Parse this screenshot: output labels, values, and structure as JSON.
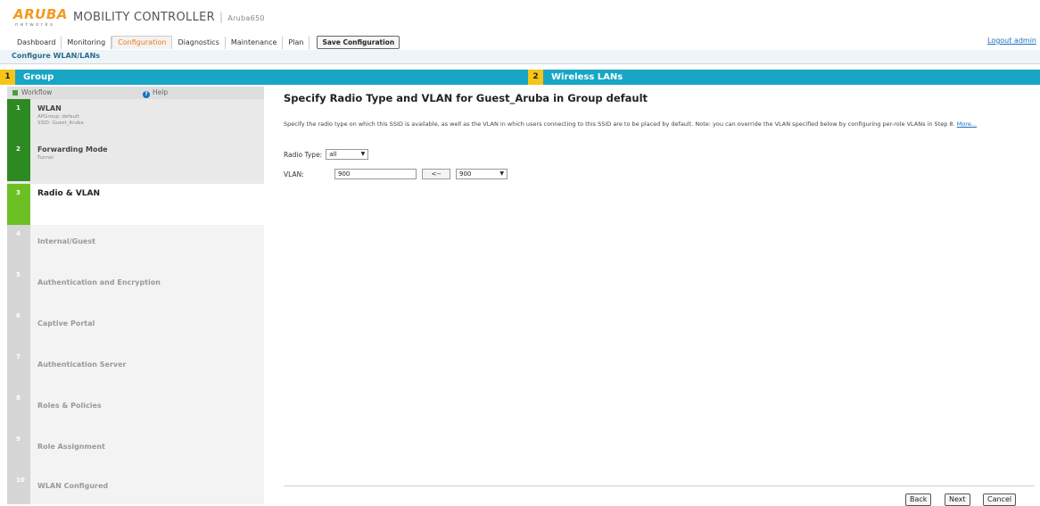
{
  "header": {
    "logo_text": "ARUBA",
    "logo_sub": "networks",
    "product": "MOBILITY CONTROLLER",
    "separator": "|",
    "hostname": "Aruba650"
  },
  "nav": {
    "tabs": [
      {
        "label": "Dashboard"
      },
      {
        "label": "Monitoring"
      },
      {
        "label": "Configuration"
      },
      {
        "label": "Diagnostics"
      },
      {
        "label": "Maintenance"
      },
      {
        "label": "Plan"
      }
    ],
    "active_tab": "Configuration",
    "save_label": "Save Configuration",
    "logout_label": "Logout admin"
  },
  "breadcrumb": "Configure WLAN/LANs",
  "stepbar": {
    "left": {
      "num": "1",
      "label": "Group"
    },
    "right": {
      "num": "2",
      "label": "Wireless LANs"
    }
  },
  "sidebar": {
    "workflow_label": "Workflow",
    "help_label": "Help",
    "steps": [
      {
        "num": "1",
        "title": "WLAN",
        "sub1": "APGroup: default",
        "sub2": "SSID: Guest_Aruba",
        "state": "done"
      },
      {
        "num": "2",
        "title": "Forwarding Mode",
        "sub1": "Tunnel",
        "sub2": "",
        "state": "done"
      },
      {
        "num": "3",
        "title": "Radio & VLAN",
        "sub1": "",
        "sub2": "",
        "state": "active"
      },
      {
        "num": "4",
        "title": "Internal/Guest",
        "sub1": "",
        "sub2": "",
        "state": "todo"
      },
      {
        "num": "5",
        "title": "Authentication and Encryption",
        "sub1": "",
        "sub2": "",
        "state": "todo"
      },
      {
        "num": "6",
        "title": "Captive Portal",
        "sub1": "",
        "sub2": "",
        "state": "todo"
      },
      {
        "num": "7",
        "title": "Authentication Server",
        "sub1": "",
        "sub2": "",
        "state": "todo"
      },
      {
        "num": "8",
        "title": "Roles & Policies",
        "sub1": "",
        "sub2": "",
        "state": "todo"
      },
      {
        "num": "9",
        "title": "Role Assignment",
        "sub1": "",
        "sub2": "",
        "state": "todo"
      },
      {
        "num": "10",
        "title": "WLAN Configured",
        "sub1": "",
        "sub2": "",
        "state": "todo"
      }
    ]
  },
  "main": {
    "heading": "Specify Radio Type and VLAN for Guest_Aruba in Group default",
    "description": "Specify the radio type on which this SSID is available, as well as the VLAN in which users connecting to this SSID are to be placed by default. Note: you can override the VLAN specified below by configuring per-role VLANs in Step 8.",
    "more_link": "More...",
    "radio_type_label": "Radio Type:",
    "radio_type_value": "all",
    "vlan_label": "VLAN:",
    "vlan_value": "900",
    "vlan_arrow": "<--",
    "vlan_select_value": "900"
  },
  "footer": {
    "back": "Back",
    "next": "Next",
    "cancel": "Cancel"
  },
  "colors": {
    "accent_orange": "#f07c1a",
    "step_blue": "#18a6c5",
    "step_yellow": "#f5c518",
    "done_green": "#2d8a22",
    "active_green": "#6cc024"
  }
}
